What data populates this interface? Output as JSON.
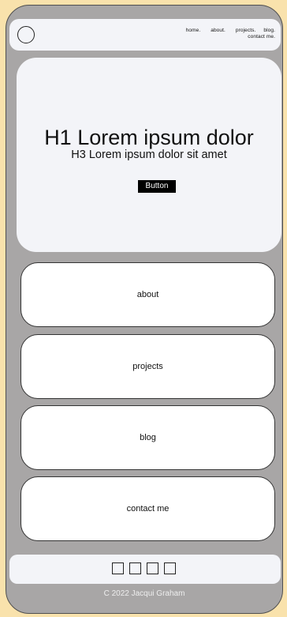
{
  "nav": {
    "items": [
      "home.",
      "about.",
      "projects.",
      "blog.",
      "contact me."
    ]
  },
  "hero": {
    "h1": "H1 Lorem ipsum dolor",
    "h3": "H3 Lorem ipsum dolor sit amet",
    "button_label": "Button"
  },
  "cards": [
    {
      "label": "about"
    },
    {
      "label": "projects"
    },
    {
      "label": "blog"
    },
    {
      "label": "contact me"
    }
  ],
  "footer": {
    "social_icons": [
      "social-icon-1",
      "social-icon-2",
      "social-icon-3",
      "social-icon-4"
    ],
    "copyright": "C 2022 Jacqui Graham"
  },
  "colors": {
    "page_background": "#f9e2ac",
    "phone_body": "#a8a6a6",
    "surface": "#f3f4f8",
    "card": "#ffffff",
    "button": "#000000"
  }
}
